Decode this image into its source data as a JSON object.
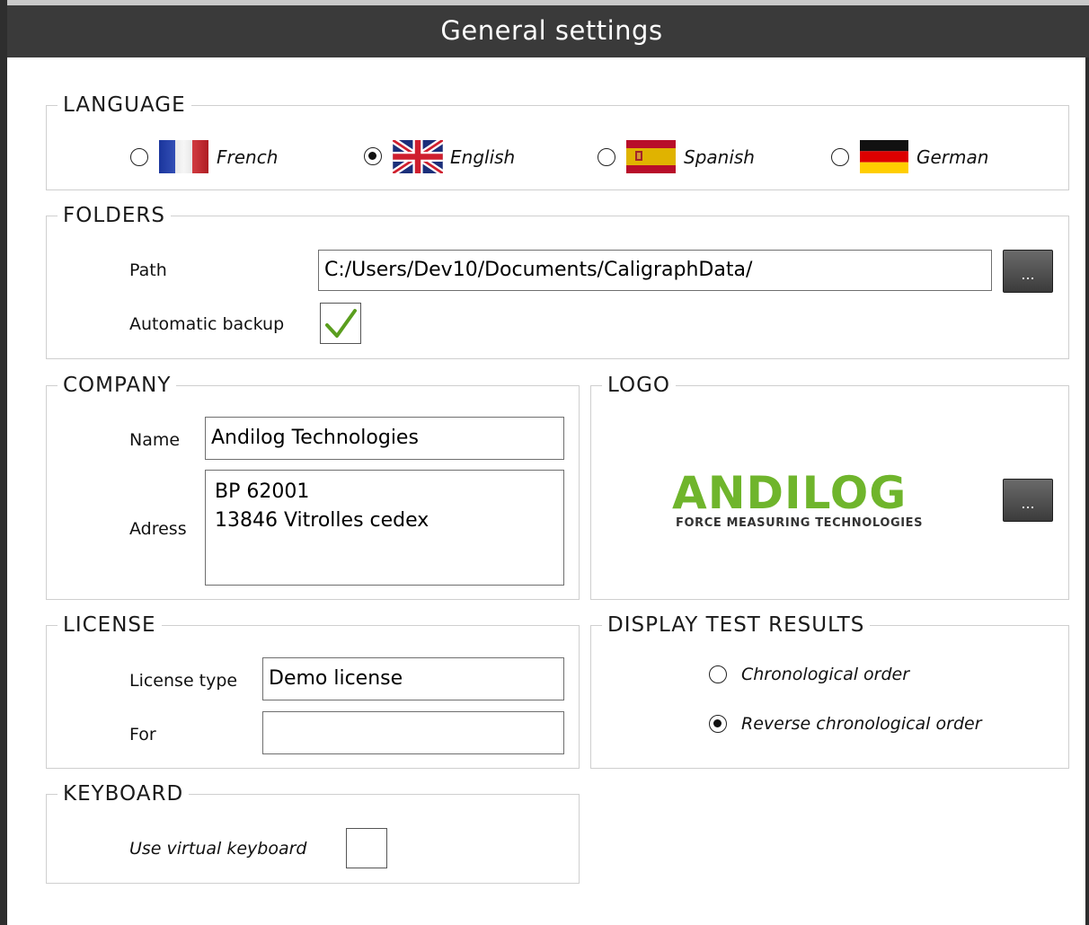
{
  "window": {
    "title": "General settings"
  },
  "language": {
    "legend": "LANGUAGE",
    "options": [
      {
        "label": "French",
        "selected": false
      },
      {
        "label": "English",
        "selected": true
      },
      {
        "label": "Spanish",
        "selected": false
      },
      {
        "label": "German",
        "selected": false
      }
    ]
  },
  "folders": {
    "legend": "FOLDERS",
    "path_label": "Path",
    "path_value": "C:/Users/Dev10/Documents/CaligraphData/",
    "browse_label": "...",
    "backup_label": "Automatic backup",
    "backup_checked": true,
    "check_color": "#5a9e1e"
  },
  "company": {
    "legend": "COMPANY",
    "name_label": "Name",
    "name_value": "Andilog Technologies",
    "address_label": "Adress",
    "address_value": "BP 62001\n13846 Vitrolles cedex"
  },
  "logo": {
    "legend": "LOGO",
    "logo_text": "ANDILOG",
    "logo_tagline": "FORCE MEASURING TECHNOLOGIES",
    "brand_color": "#6fb52c",
    "browse_label": "..."
  },
  "license": {
    "legend": "LICENSE",
    "type_label": "License type",
    "type_value": "Demo license",
    "for_label": "For",
    "for_value": ""
  },
  "display": {
    "legend": "DISPLAY TEST RESULTS",
    "options": [
      {
        "label": "Chronological order",
        "selected": false
      },
      {
        "label": "Reverse chronological order",
        "selected": true
      }
    ]
  },
  "keyboard": {
    "legend": "KEYBOARD",
    "virtual_label": "Use virtual keyboard",
    "virtual_checked": false
  }
}
